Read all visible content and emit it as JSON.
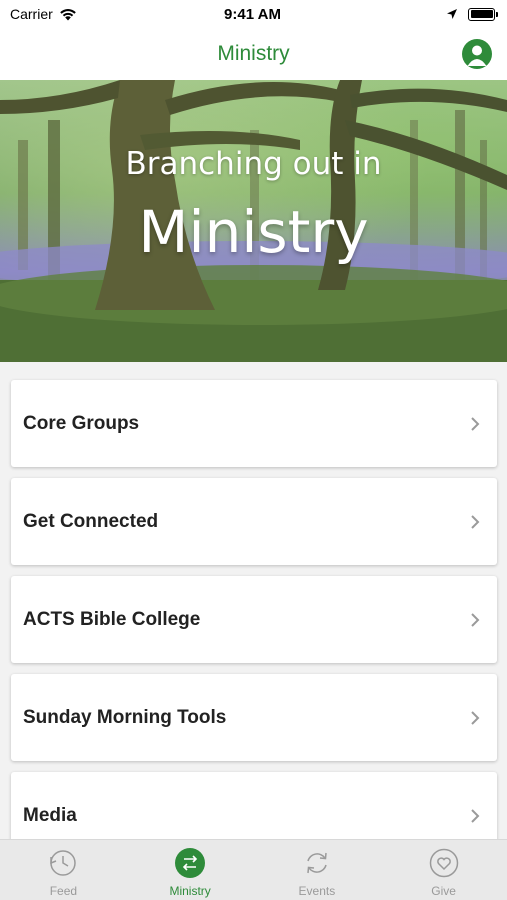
{
  "status_bar": {
    "carrier": "Carrier",
    "time": "9:41 AM",
    "battery_level": 1.0
  },
  "nav": {
    "title": "Ministry",
    "profile_icon": "person-icon"
  },
  "hero": {
    "subtitle": "Branching out in",
    "title": "Ministry"
  },
  "menu": {
    "items": [
      {
        "label": "Core Groups"
      },
      {
        "label": "Get Connected"
      },
      {
        "label": "ACTS Bible College"
      },
      {
        "label": "Sunday Morning Tools"
      },
      {
        "label": "Media"
      }
    ]
  },
  "tabs": {
    "items": [
      {
        "label": "Feed",
        "icon": "history-icon",
        "active": false
      },
      {
        "label": "Ministry",
        "icon": "swap-arrows-icon",
        "active": true
      },
      {
        "label": "Events",
        "icon": "refresh-icon",
        "active": false
      },
      {
        "label": "Give",
        "icon": "heart-icon",
        "active": false
      }
    ]
  },
  "colors": {
    "accent": "#2e8b3a",
    "tab_inactive": "#9a9a9a",
    "background": "#f2f2f2"
  }
}
